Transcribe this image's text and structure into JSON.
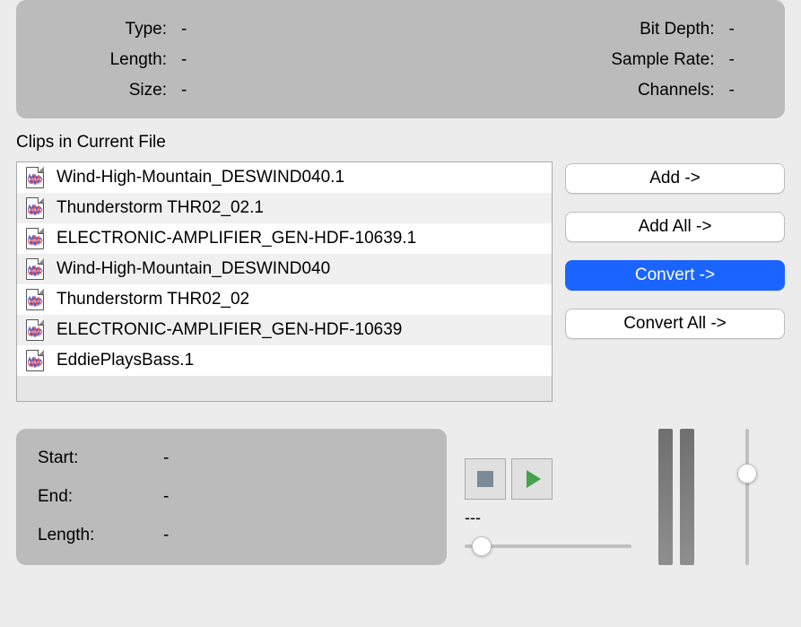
{
  "info": {
    "left": [
      {
        "label": "Type:",
        "value": "-"
      },
      {
        "label": "Length:",
        "value": "-"
      },
      {
        "label": "Size:",
        "value": "-"
      }
    ],
    "right": [
      {
        "label": "Bit Depth:",
        "value": "-"
      },
      {
        "label": "Sample Rate:",
        "value": "-"
      },
      {
        "label": "Channels:",
        "value": "-"
      }
    ]
  },
  "section_title": "Clips in Current File",
  "clips": [
    "Wind-High-Mountain_DESWIND040.1",
    "Thunderstorm THR02_02.1",
    "ELECTRONIC-AMPLIFIER_GEN-HDF-10639.1",
    "Wind-High-Mountain_DESWIND040",
    "Thunderstorm THR02_02",
    "ELECTRONIC-AMPLIFIER_GEN-HDF-10639",
    "EddiePlaysBass.1"
  ],
  "buttons": {
    "add": "Add ->",
    "add_all": "Add All ->",
    "convert": "Convert ->",
    "convert_all": "Convert All ->",
    "selected": "convert"
  },
  "position": {
    "start": {
      "label": "Start:",
      "value": "-"
    },
    "end": {
      "label": "End:",
      "value": "-"
    },
    "length": {
      "label": "Length:",
      "value": "-"
    }
  },
  "transport": {
    "readout": "---",
    "position_slider": 0.05,
    "volume_slider": 0.7
  },
  "icons": {
    "audio_clip": "audio-clip-icon",
    "stop": "stop-icon",
    "play": "play-icon"
  },
  "colors": {
    "panel_bg": "#bbbbbb",
    "window_bg": "#ececec",
    "accent": "#1a64ff",
    "play_green": "#44a24a"
  }
}
